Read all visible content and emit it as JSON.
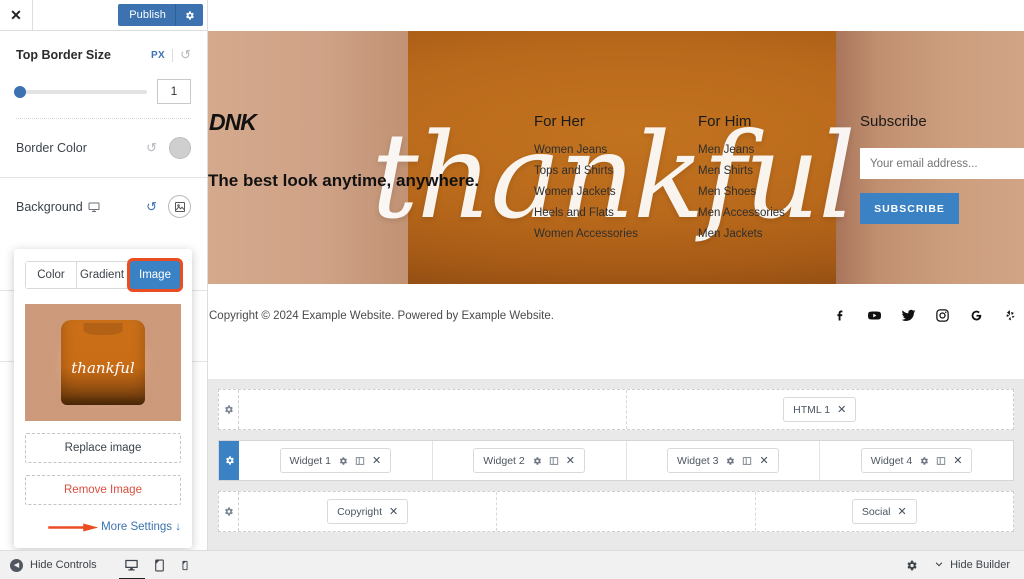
{
  "customizer": {
    "close_icon": "close-icon",
    "publish_label": "Publish",
    "publish_gear_icon": "gear-icon",
    "border_size": {
      "label": "Top Border Size",
      "unit": "PX",
      "value": "1",
      "reset_icon": "reset-icon"
    },
    "border_color": {
      "label": "Border Color",
      "reset_icon": "reset-icon",
      "swatch_color": "#cfcfcf"
    },
    "background": {
      "label": "Background",
      "device_icon": "desktop-icon",
      "reset_icon": "reset-icon",
      "image_toggle_icon": "image-icon",
      "tabs": [
        "Color",
        "Gradient",
        "Image"
      ],
      "active_tab": "Image",
      "thumbnail_alt": "thankful",
      "replace_label": "Replace image",
      "remove_label": "Remove Image",
      "more_settings_label": "More Settings ↓",
      "annotation": "orange-arrow"
    },
    "footer": {
      "hide_controls_label": "Hide Controls",
      "devices": [
        "desktop-icon",
        "tablet-icon",
        "mobile-icon"
      ],
      "active_device": "desktop-icon"
    }
  },
  "preview": {
    "brand": "DNK",
    "tagline": "The best look anytime, anywhere.",
    "script_word": "thankful",
    "columns": [
      {
        "title": "For Her",
        "links": [
          "Women Jeans",
          "Tops and Shirts",
          "Women Jackets",
          "Heels and Flats",
          "Women Accessories"
        ]
      },
      {
        "title": "For Him",
        "links": [
          "Men Jeans",
          "Men Shirts",
          "Men Shoes",
          "Men Accessories",
          "Men Jackets"
        ]
      }
    ],
    "subscribe": {
      "title": "Subscribe",
      "placeholder": "Your email address...",
      "button_label": "SUBSCRIBE",
      "button_color": "#3b82c4"
    },
    "copyright": "Copyright © 2024 Example Website. Powered by Example Website.",
    "socials": [
      "facebook-icon",
      "youtube-icon",
      "twitter-icon",
      "instagram-icon",
      "google-icon",
      "yelp-icon"
    ]
  },
  "builder": {
    "rows": [
      {
        "gear_icon": "gear-icon",
        "selected": false,
        "columns": [
          {
            "chips": []
          },
          {
            "chips": [
              {
                "label": "HTML 1",
                "icons": [
                  "close-icon"
                ]
              }
            ]
          }
        ]
      },
      {
        "gear_icon": "gear-icon",
        "selected": true,
        "columns": [
          {
            "chips": [
              {
                "label": "Widget 1",
                "icons": [
                  "gear-icon",
                  "column-icon",
                  "close-icon"
                ]
              }
            ]
          },
          {
            "chips": [
              {
                "label": "Widget 2",
                "icons": [
                  "gear-icon",
                  "column-icon",
                  "close-icon"
                ]
              }
            ]
          },
          {
            "chips": [
              {
                "label": "Widget 3",
                "icons": [
                  "gear-icon",
                  "column-icon",
                  "close-icon"
                ]
              }
            ]
          },
          {
            "chips": [
              {
                "label": "Widget 4",
                "icons": [
                  "gear-icon",
                  "column-icon",
                  "close-icon"
                ]
              }
            ]
          }
        ]
      },
      {
        "gear_icon": "gear-icon",
        "selected": false,
        "columns": [
          {
            "chips": [
              {
                "label": "Copyright",
                "icons": [
                  "close-icon"
                ]
              }
            ]
          },
          {
            "chips": []
          },
          {
            "chips": [
              {
                "label": "Social",
                "icons": [
                  "close-icon"
                ]
              }
            ]
          }
        ]
      }
    ],
    "bar": {
      "gear_icon": "gear-icon",
      "hide_builder_label": "Hide Builder",
      "chevron_icon": "chevron-down-icon"
    }
  }
}
